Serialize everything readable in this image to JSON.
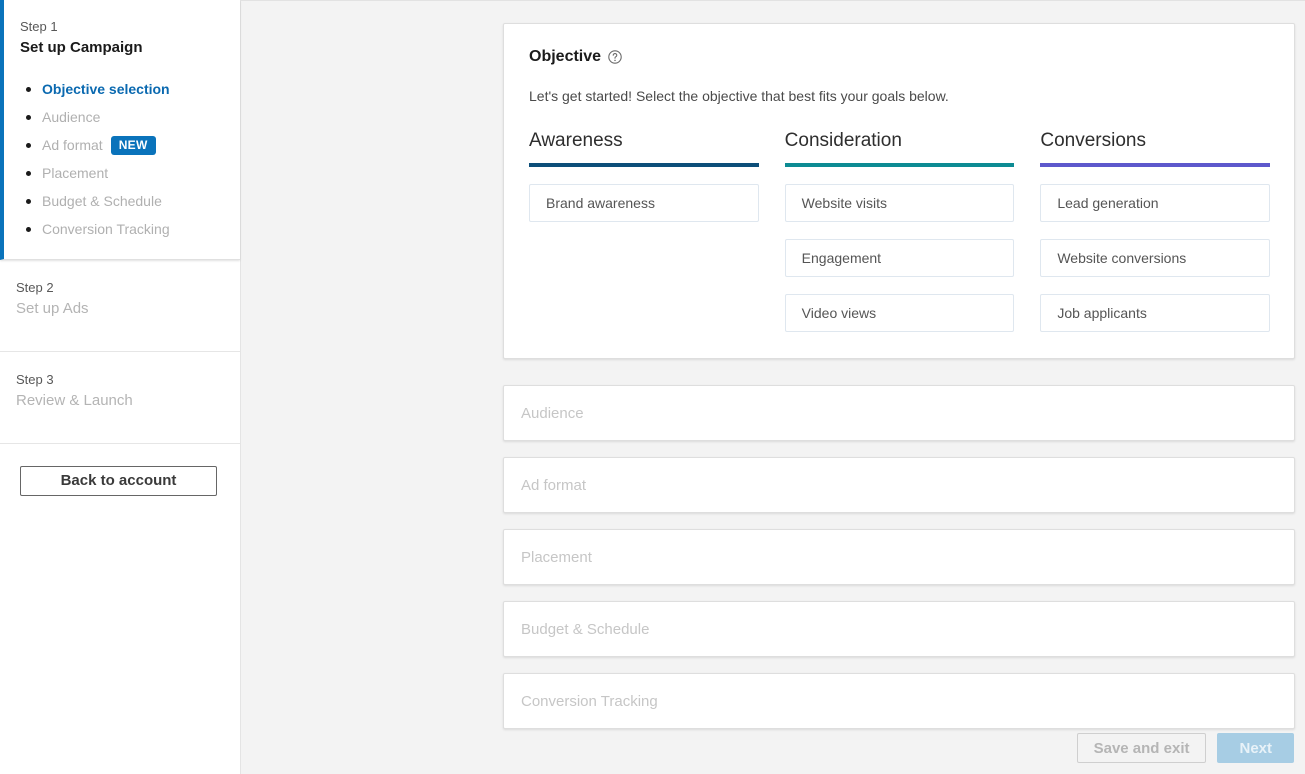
{
  "sidebar": {
    "steps": [
      {
        "label": "Step 1",
        "title": "Set up Campaign",
        "state": "active",
        "substeps": [
          {
            "label": "Objective selection",
            "current": true,
            "badge": ""
          },
          {
            "label": "Audience",
            "current": false,
            "badge": ""
          },
          {
            "label": "Ad format",
            "current": false,
            "badge": "NEW"
          },
          {
            "label": "Placement",
            "current": false,
            "badge": ""
          },
          {
            "label": "Budget & Schedule",
            "current": false,
            "badge": ""
          },
          {
            "label": "Conversion Tracking",
            "current": false,
            "badge": ""
          }
        ]
      },
      {
        "label": "Step 2",
        "title": "Set up Ads",
        "state": "inactive",
        "substeps": []
      },
      {
        "label": "Step 3",
        "title": "Review & Launch",
        "state": "inactive",
        "substeps": []
      }
    ],
    "back_button_label": "Back to account"
  },
  "objective_card": {
    "heading": "Objective",
    "help_icon": "help-circle-icon",
    "subtitle": "Let's get started! Select the objective that best fits your goals below.",
    "columns": [
      {
        "title": "Awareness",
        "accent": "#0d4e79",
        "options": [
          "Brand awareness"
        ]
      },
      {
        "title": "Consideration",
        "accent": "#0d8b93",
        "options": [
          "Website visits",
          "Engagement",
          "Video views"
        ]
      },
      {
        "title": "Conversions",
        "accent": "#5d58cc",
        "options": [
          "Lead generation",
          "Website conversions",
          "Job applicants"
        ]
      }
    ]
  },
  "sections": [
    {
      "title": "Audience"
    },
    {
      "title": "Ad format"
    },
    {
      "title": "Placement"
    },
    {
      "title": "Budget & Schedule"
    },
    {
      "title": "Conversion Tracking"
    }
  ],
  "footer": {
    "save_label": "Save and exit",
    "next_label": "Next"
  }
}
